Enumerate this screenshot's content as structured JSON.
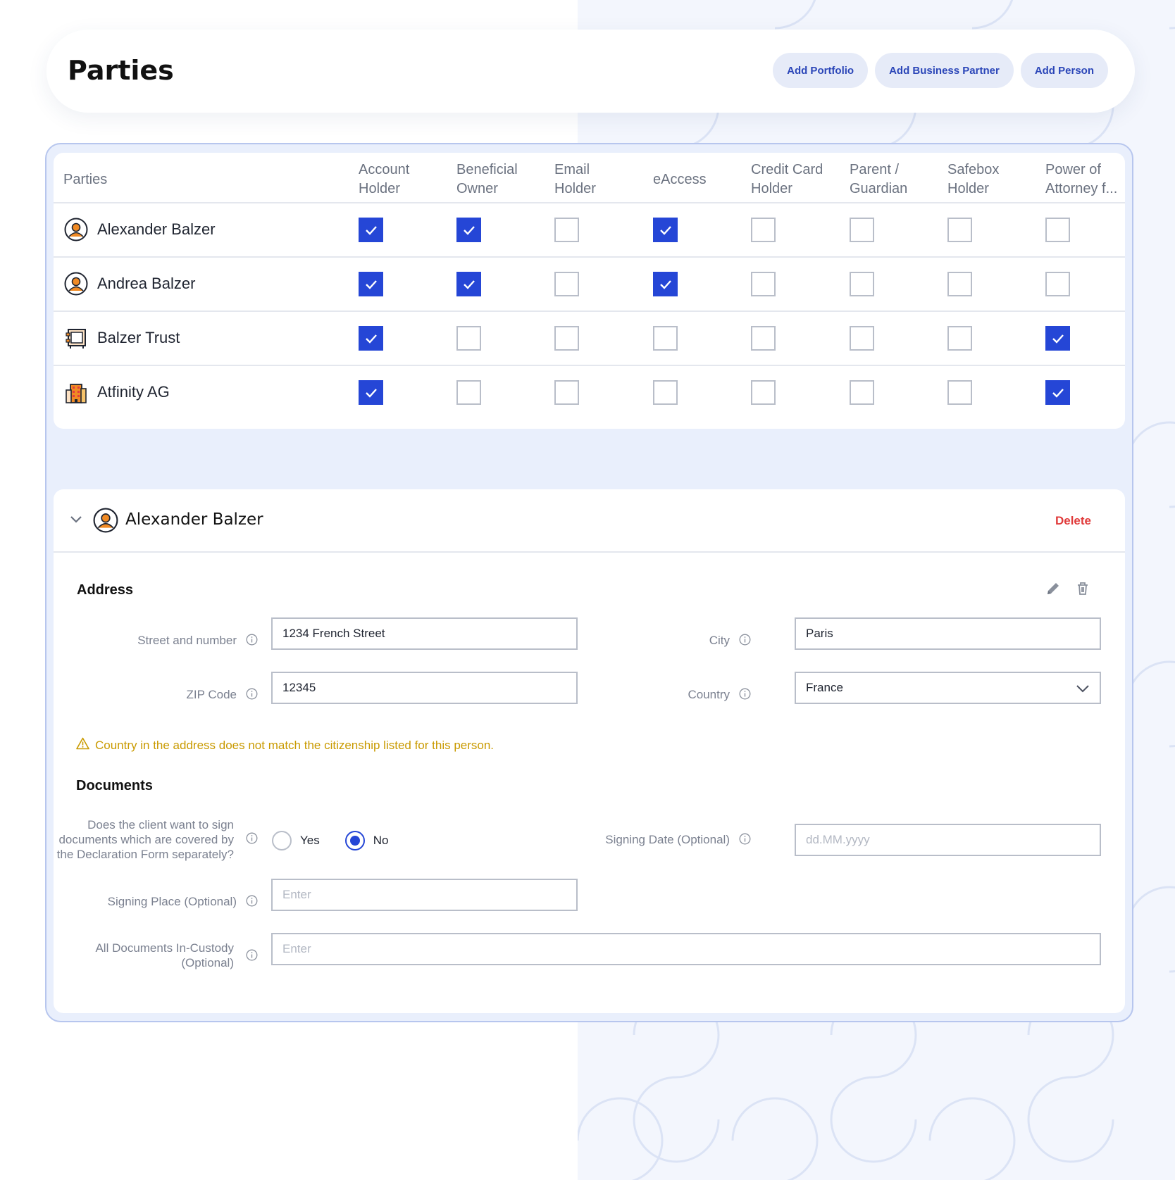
{
  "header": {
    "title": "Parties",
    "buttons": {
      "add_portfolio": "Add Portfolio",
      "add_business_partner": "Add Business Partner",
      "add_person": "Add Person"
    }
  },
  "table": {
    "columns": [
      "Parties",
      "Account\nHolder",
      "Beneficial\nOwner",
      "Email\nHolder",
      "eAccess",
      "Credit Card\nHolder",
      "Parent /\nGuardian",
      "Safebox\nHolder",
      "Power of\nAttorney f..."
    ],
    "rows": [
      {
        "name": "Alexander Balzer",
        "icon": "person-avatar-icon",
        "checks": [
          true,
          true,
          false,
          true,
          false,
          false,
          false,
          false
        ]
      },
      {
        "name": "Andrea Balzer",
        "icon": "person-avatar-icon",
        "checks": [
          true,
          true,
          false,
          true,
          false,
          false,
          false,
          false
        ]
      },
      {
        "name": "Balzer Trust",
        "icon": "trust-icon",
        "checks": [
          true,
          false,
          false,
          false,
          false,
          false,
          false,
          true
        ]
      },
      {
        "name": "Atfinity AG",
        "icon": "company-building-icon",
        "checks": [
          true,
          false,
          false,
          false,
          false,
          false,
          false,
          true
        ]
      }
    ]
  },
  "detail": {
    "name": "Alexander Balzer",
    "delete_label": "Delete",
    "address": {
      "title": "Address",
      "street_label": "Street and number",
      "street_value": "1234 French Street",
      "city_label": "City",
      "city_value": "Paris",
      "zip_label": "ZIP Code",
      "zip_value": "12345",
      "country_label": "Country",
      "country_value": "France",
      "warning": "Country in the address does not match the citizenship listed for this person."
    },
    "documents": {
      "title": "Documents",
      "sign_question": "Does the client want to sign documents which are covered by the Declaration Form separately?",
      "yes_label": "Yes",
      "no_label": "No",
      "selected": "No",
      "signing_date_label": "Signing Date (Optional)",
      "signing_date_placeholder": "dd.MM.yyyy",
      "signing_place_label": "Signing Place (Optional)",
      "signing_place_placeholder": "Enter",
      "custody_label": "All Documents In-Custody (Optional)",
      "custody_placeholder": "Enter"
    }
  },
  "colors": {
    "accent": "#2546d6",
    "danger": "#e03b3b",
    "warning": "#c99a00",
    "pill_bg": "#e6ebf8"
  }
}
